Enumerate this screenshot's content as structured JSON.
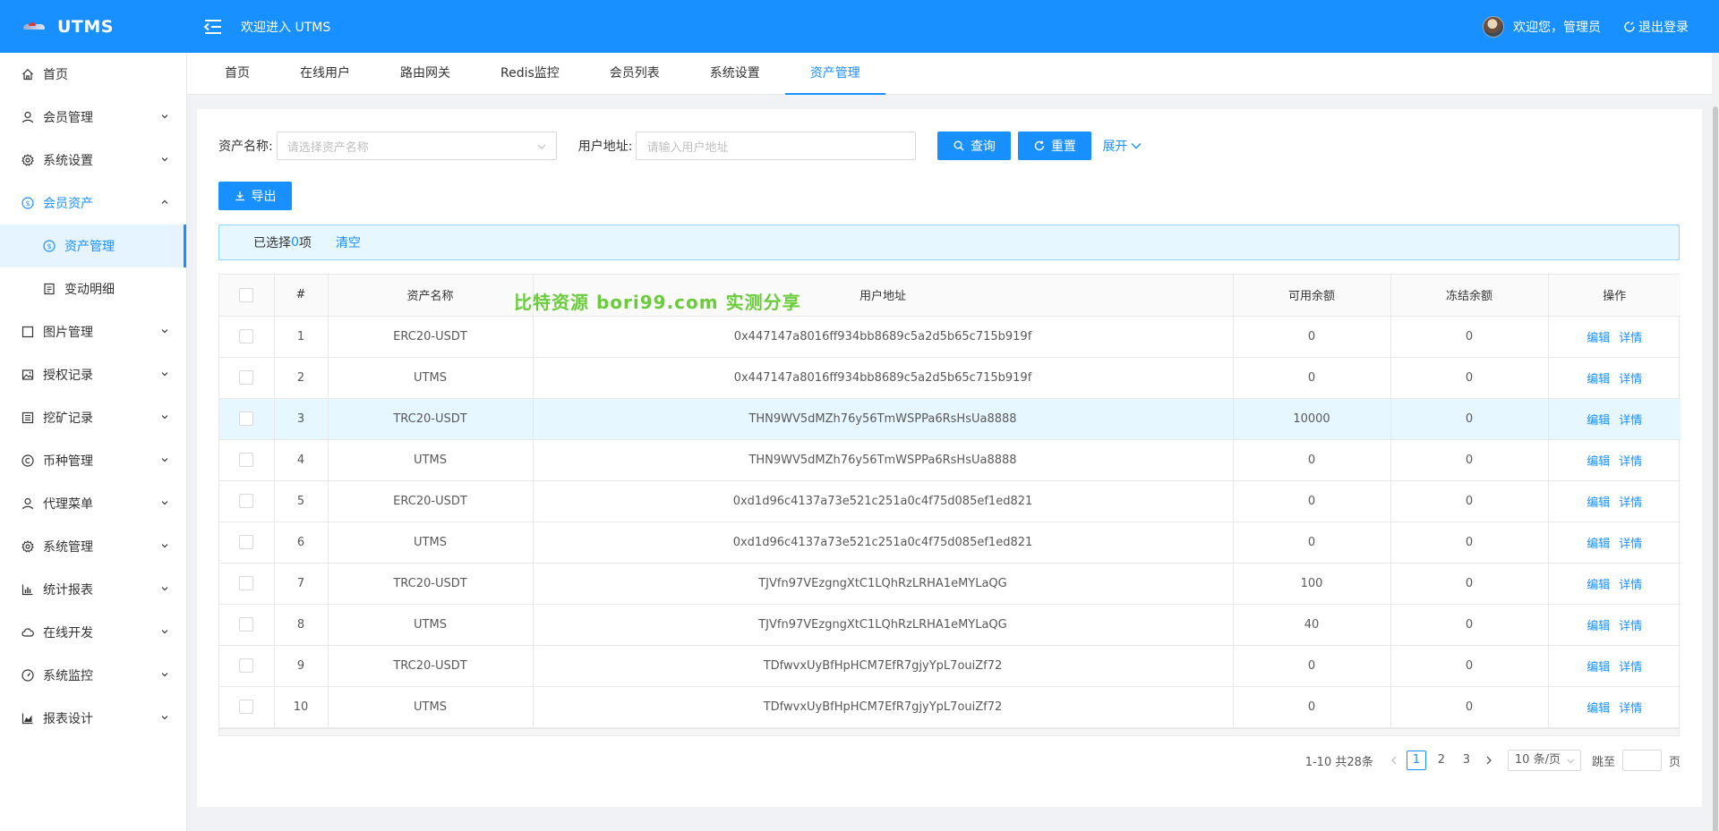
{
  "header": {
    "logo_text": "UTMS",
    "welcome": "欢迎进入 UTMS",
    "user_greeting": "欢迎您，管理员",
    "logout": "退出登录"
  },
  "sidebar": {
    "items": [
      {
        "label": "首页",
        "icon": "home-icon"
      },
      {
        "label": "会员管理",
        "icon": "user-icon"
      },
      {
        "label": "系统设置",
        "icon": "gear-icon"
      },
      {
        "label": "会员资产",
        "icon": "dollar-circle-icon"
      },
      {
        "label": "资产管理",
        "icon": "dollar-circle-icon"
      },
      {
        "label": "变动明细",
        "icon": "file-text-icon"
      },
      {
        "label": "图片管理",
        "icon": "image-frame-icon"
      },
      {
        "label": "授权记录",
        "icon": "picture-icon"
      },
      {
        "label": "挖矿记录",
        "icon": "list-icon"
      },
      {
        "label": "币种管理",
        "icon": "copyright-icon"
      },
      {
        "label": "代理菜单",
        "icon": "user-icon"
      },
      {
        "label": "系统管理",
        "icon": "gear-icon"
      },
      {
        "label": "统计报表",
        "icon": "bar-chart-icon"
      },
      {
        "label": "在线开发",
        "icon": "cloud-icon"
      },
      {
        "label": "系统监控",
        "icon": "dashboard-icon"
      },
      {
        "label": "报表设计",
        "icon": "area-chart-icon"
      }
    ]
  },
  "tabs": [
    "首页",
    "在线用户",
    "路由网关",
    "Redis监控",
    "会员列表",
    "系统设置",
    "资产管理"
  ],
  "search": {
    "asset_label": "资产名称:",
    "asset_placeholder": "请选择资产名称",
    "address_label": "用户地址:",
    "address_placeholder": "请输入用户地址",
    "query": "查询",
    "reset": "重置",
    "expand": "展开"
  },
  "toolbar": {
    "export": "导出"
  },
  "selection": {
    "prefix": "已选择",
    "count": "0",
    "suffix": "项",
    "clear": "清空"
  },
  "table": {
    "columns": [
      "#",
      "资产名称",
      "用户地址",
      "可用余额",
      "冻结余额",
      "操作"
    ],
    "edit": "编辑",
    "detail": "详情",
    "rows": [
      {
        "no": "1",
        "asset": "ERC20-USDT",
        "address": "0x447147a8016ff934bb8689c5a2d5b65c715b919f",
        "available": "0",
        "frozen": "0"
      },
      {
        "no": "2",
        "asset": "UTMS",
        "address": "0x447147a8016ff934bb8689c5a2d5b65c715b919f",
        "available": "0",
        "frozen": "0"
      },
      {
        "no": "3",
        "asset": "TRC20-USDT",
        "address": "THN9WV5dMZh76y56TmWSPPa6RsHsUa8888",
        "available": "10000",
        "frozen": "0"
      },
      {
        "no": "4",
        "asset": "UTMS",
        "address": "THN9WV5dMZh76y56TmWSPPa6RsHsUa8888",
        "available": "0",
        "frozen": "0"
      },
      {
        "no": "5",
        "asset": "ERC20-USDT",
        "address": "0xd1d96c4137a73e521c251a0c4f75d085ef1ed821",
        "available": "0",
        "frozen": "0"
      },
      {
        "no": "6",
        "asset": "UTMS",
        "address": "0xd1d96c4137a73e521c251a0c4f75d085ef1ed821",
        "available": "0",
        "frozen": "0"
      },
      {
        "no": "7",
        "asset": "TRC20-USDT",
        "address": "TJVfn97VEzgngXtC1LQhRzLRHA1eMYLaQG",
        "available": "100",
        "frozen": "0"
      },
      {
        "no": "8",
        "asset": "UTMS",
        "address": "TJVfn97VEzgngXtC1LQhRzLRHA1eMYLaQG",
        "available": "40",
        "frozen": "0"
      },
      {
        "no": "9",
        "asset": "TRC20-USDT",
        "address": "TDfwvxUyBfHpHCM7EfR7gjyYpL7ouiZf72",
        "available": "0",
        "frozen": "0"
      },
      {
        "no": "10",
        "asset": "UTMS",
        "address": "TDfwvxUyBfHpHCM7EfR7gjyYpL7ouiZf72",
        "available": "0",
        "frozen": "0"
      }
    ]
  },
  "watermark": "比特资源 bori99.com 实测分享",
  "pagination": {
    "summary": "1-10 共28条",
    "pages": [
      "1",
      "2",
      "3"
    ],
    "current": "1",
    "page_size": "10 条/页",
    "jump_label": "跳至",
    "page_suffix": "页"
  }
}
